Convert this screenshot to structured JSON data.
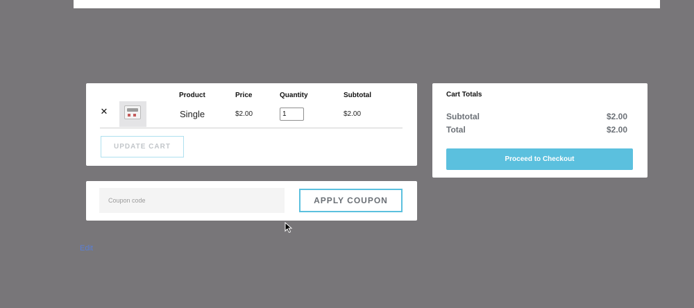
{
  "cart": {
    "headers": {
      "product": "Product",
      "price": "Price",
      "quantity": "Quantity",
      "subtotal": "Subtotal"
    },
    "items": [
      {
        "remove_icon": "close-icon",
        "name": "Single",
        "price": "$2.00",
        "quantity": "1",
        "subtotal": "$2.00"
      }
    ],
    "update_label": "UPDATE CART"
  },
  "coupon": {
    "placeholder": "Coupon code",
    "apply_label": "APPLY COUPON"
  },
  "totals": {
    "title": "Cart Totals",
    "subtotal_label": "Subtotal",
    "subtotal_value": "$2.00",
    "total_label": "Total",
    "total_value": "$2.00",
    "checkout_label": "Proceed to Checkout"
  },
  "page": {
    "link_text": "Edit"
  },
  "colors": {
    "accent": "#5bc0de",
    "background": "#787679"
  }
}
